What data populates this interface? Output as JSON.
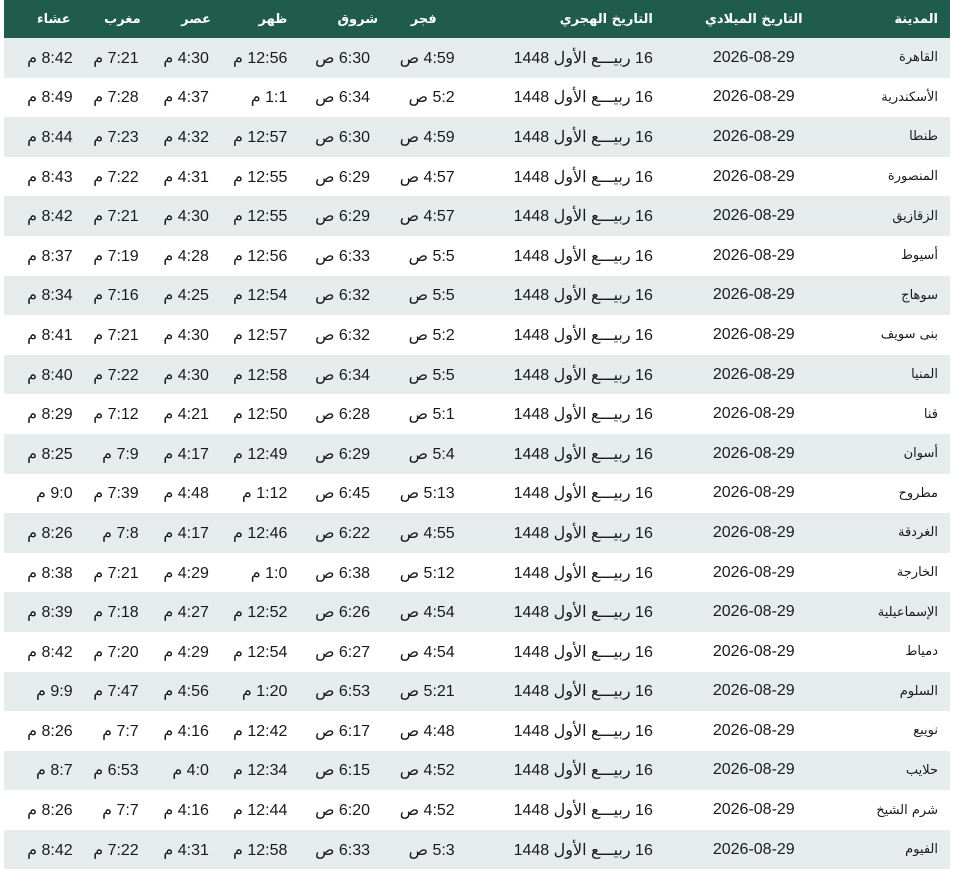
{
  "table": {
    "headers": {
      "city": "المدينة",
      "gregorian": "التاريخ الميلادي",
      "hijri": "التاريخ الهجري",
      "fajr": "فجر",
      "sunrise": "شروق",
      "dhuhr": "ظهر",
      "asr": "عصر",
      "maghrib": "مغرب",
      "isha": "عشاء"
    },
    "rows": [
      {
        "city": "القاهرة",
        "gregorian": "2026-08-29",
        "hijri": "16 ربيـــع الأول 1448",
        "fajr": "4:59 ص",
        "sunrise": "6:30 ص",
        "dhuhr": "12:56 م",
        "asr": "4:30 م",
        "maghrib": "7:21 م",
        "isha": "8:42 م"
      },
      {
        "city": "الأسكندرية",
        "gregorian": "2026-08-29",
        "hijri": "16 ربيـــع الأول 1448",
        "fajr": "5:2 ص",
        "sunrise": "6:34 ص",
        "dhuhr": "1:1 م",
        "asr": "4:37 م",
        "maghrib": "7:28 م",
        "isha": "8:49 م"
      },
      {
        "city": "طنطا",
        "gregorian": "2026-08-29",
        "hijri": "16 ربيـــع الأول 1448",
        "fajr": "4:59 ص",
        "sunrise": "6:30 ص",
        "dhuhr": "12:57 م",
        "asr": "4:32 م",
        "maghrib": "7:23 م",
        "isha": "8:44 م"
      },
      {
        "city": "المنصورة",
        "gregorian": "2026-08-29",
        "hijri": "16 ربيـــع الأول 1448",
        "fajr": "4:57 ص",
        "sunrise": "6:29 ص",
        "dhuhr": "12:55 م",
        "asr": "4:31 م",
        "maghrib": "7:22 م",
        "isha": "8:43 م"
      },
      {
        "city": "الزقازيق",
        "gregorian": "2026-08-29",
        "hijri": "16 ربيـــع الأول 1448",
        "fajr": "4:57 ص",
        "sunrise": "6:29 ص",
        "dhuhr": "12:55 م",
        "asr": "4:30 م",
        "maghrib": "7:21 م",
        "isha": "8:42 م"
      },
      {
        "city": "أسيوط",
        "gregorian": "2026-08-29",
        "hijri": "16 ربيـــع الأول 1448",
        "fajr": "5:5 ص",
        "sunrise": "6:33 ص",
        "dhuhr": "12:56 م",
        "asr": "4:28 م",
        "maghrib": "7:19 م",
        "isha": "8:37 م"
      },
      {
        "city": "سوهاج",
        "gregorian": "2026-08-29",
        "hijri": "16 ربيـــع الأول 1448",
        "fajr": "5:5 ص",
        "sunrise": "6:32 ص",
        "dhuhr": "12:54 م",
        "asr": "4:25 م",
        "maghrib": "7:16 م",
        "isha": "8:34 م"
      },
      {
        "city": "بنى سويف",
        "gregorian": "2026-08-29",
        "hijri": "16 ربيـــع الأول 1448",
        "fajr": "5:2 ص",
        "sunrise": "6:32 ص",
        "dhuhr": "12:57 م",
        "asr": "4:30 م",
        "maghrib": "7:21 م",
        "isha": "8:41 م"
      },
      {
        "city": "المنيا",
        "gregorian": "2026-08-29",
        "hijri": "16 ربيـــع الأول 1448",
        "fajr": "5:5 ص",
        "sunrise": "6:34 ص",
        "dhuhr": "12:58 م",
        "asr": "4:30 م",
        "maghrib": "7:22 م",
        "isha": "8:40 م"
      },
      {
        "city": "قنا",
        "gregorian": "2026-08-29",
        "hijri": "16 ربيـــع الأول 1448",
        "fajr": "5:1 ص",
        "sunrise": "6:28 ص",
        "dhuhr": "12:50 م",
        "asr": "4:21 م",
        "maghrib": "7:12 م",
        "isha": "8:29 م"
      },
      {
        "city": "أسوان",
        "gregorian": "2026-08-29",
        "hijri": "16 ربيـــع الأول 1448",
        "fajr": "5:4 ص",
        "sunrise": "6:29 ص",
        "dhuhr": "12:49 م",
        "asr": "4:17 م",
        "maghrib": "7:9 م",
        "isha": "8:25 م"
      },
      {
        "city": "مطروح",
        "gregorian": "2026-08-29",
        "hijri": "16 ربيـــع الأول 1448",
        "fajr": "5:13 ص",
        "sunrise": "6:45 ص",
        "dhuhr": "1:12 م",
        "asr": "4:48 م",
        "maghrib": "7:39 م",
        "isha": "9:0 م"
      },
      {
        "city": "الغردقة",
        "gregorian": "2026-08-29",
        "hijri": "16 ربيـــع الأول 1448",
        "fajr": "4:55 ص",
        "sunrise": "6:22 ص",
        "dhuhr": "12:46 م",
        "asr": "4:17 م",
        "maghrib": "7:8 م",
        "isha": "8:26 م"
      },
      {
        "city": "الخارجة",
        "gregorian": "2026-08-29",
        "hijri": "16 ربيـــع الأول 1448",
        "fajr": "5:12 ص",
        "sunrise": "6:38 ص",
        "dhuhr": "1:0 م",
        "asr": "4:29 م",
        "maghrib": "7:21 م",
        "isha": "8:38 م"
      },
      {
        "city": "الإسماعيلية",
        "gregorian": "2026-08-29",
        "hijri": "16 ربيـــع الأول 1448",
        "fajr": "4:54 ص",
        "sunrise": "6:26 ص",
        "dhuhr": "12:52 م",
        "asr": "4:27 م",
        "maghrib": "7:18 م",
        "isha": "8:39 م"
      },
      {
        "city": "دمياط",
        "gregorian": "2026-08-29",
        "hijri": "16 ربيـــع الأول 1448",
        "fajr": "4:54 ص",
        "sunrise": "6:27 ص",
        "dhuhr": "12:54 م",
        "asr": "4:29 م",
        "maghrib": "7:20 م",
        "isha": "8:42 م"
      },
      {
        "city": "السلوم",
        "gregorian": "2026-08-29",
        "hijri": "16 ربيـــع الأول 1448",
        "fajr": "5:21 ص",
        "sunrise": "6:53 ص",
        "dhuhr": "1:20 م",
        "asr": "4:56 م",
        "maghrib": "7:47 م",
        "isha": "9:9 م"
      },
      {
        "city": "نويبع",
        "gregorian": "2026-08-29",
        "hijri": "16 ربيـــع الأول 1448",
        "fajr": "4:48 ص",
        "sunrise": "6:17 ص",
        "dhuhr": "12:42 م",
        "asr": "4:16 م",
        "maghrib": "7:7 م",
        "isha": "8:26 م"
      },
      {
        "city": "حلايب",
        "gregorian": "2026-08-29",
        "hijri": "16 ربيـــع الأول 1448",
        "fajr": "4:52 ص",
        "sunrise": "6:15 ص",
        "dhuhr": "12:34 م",
        "asr": "4:0 م",
        "maghrib": "6:53 م",
        "isha": "8:7 م"
      },
      {
        "city": "شرم الشيخ",
        "gregorian": "2026-08-29",
        "hijri": "16 ربيـــع الأول 1448",
        "fajr": "4:52 ص",
        "sunrise": "6:20 ص",
        "dhuhr": "12:44 م",
        "asr": "4:16 م",
        "maghrib": "7:7 م",
        "isha": "8:26 م"
      },
      {
        "city": "الفيوم",
        "gregorian": "2026-08-29",
        "hijri": "16 ربيـــع الأول 1448",
        "fajr": "5:3 ص",
        "sunrise": "6:33 ص",
        "dhuhr": "12:58 م",
        "asr": "4:31 م",
        "maghrib": "7:22 م",
        "isha": "8:42 م"
      }
    ]
  },
  "colors": {
    "header_bg": "#1f5c4c",
    "row_alt_bg": "#e6ebec",
    "row_bg": "#ffffff"
  }
}
